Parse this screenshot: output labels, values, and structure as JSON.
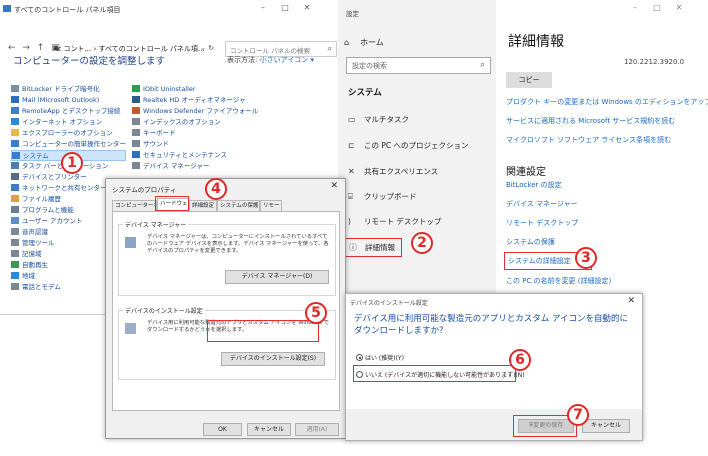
{
  "control_panel": {
    "title": "すべてのコントロール パネル項目",
    "path": "≪ コント... › すべてのコントロール パネル項...",
    "search_placeholder": "コントロール パネルの検索",
    "heading": "コンピューターの設定を調整します",
    "view_by_label": "表示方法:",
    "view_by_value": "小さいアイコン ▾",
    "col1": [
      {
        "label": "BitLocker ドライブ暗号化",
        "color": "#7a8fa8"
      },
      {
        "label": "Mail (Microsoft Outlook)",
        "color": "#2e6dbf"
      },
      {
        "label": "RemoteApp とデスクトップ接続",
        "color": "#3b7fc9"
      },
      {
        "label": "インターネット オプション",
        "color": "#2f88d6"
      },
      {
        "label": "エクスプローラーのオプション",
        "color": "#e5b94a"
      },
      {
        "label": "コンピューターの簡単操作センター",
        "color": "#3a7ed0"
      },
      {
        "label": "システム",
        "color": "#3a7ed0"
      },
      {
        "label": "タスク バーとナビゲーション",
        "color": "#4a7fb5"
      },
      {
        "label": "デバイスとプリンター",
        "color": "#5a6d80"
      },
      {
        "label": "ネットワークと共有センター",
        "color": "#3d7cc6"
      },
      {
        "label": "ファイル履歴",
        "color": "#e2a23a"
      },
      {
        "label": "プログラムと機能",
        "color": "#6b7f93"
      },
      {
        "label": "ユーザー アカウント",
        "color": "#5b8fc7"
      },
      {
        "label": "音声認識",
        "color": "#7a8a99"
      },
      {
        "label": "管理ツール",
        "color": "#7b8793"
      },
      {
        "label": "記憶域",
        "color": "#7b8793"
      },
      {
        "label": "自動再生",
        "color": "#3a9a55"
      },
      {
        "label": "地域",
        "color": "#2f88d6"
      },
      {
        "label": "電話とモデム",
        "color": "#7b8793"
      }
    ],
    "col2": [
      {
        "label": "IObit Uninstaller",
        "color": "#2aa04a"
      },
      {
        "label": "Realtek HD オーディオマネージャ",
        "color": "#2c5a8a"
      },
      {
        "label": "Windows Defender ファイアウォール",
        "color": "#c55a2a"
      },
      {
        "label": "インデックスのオプション",
        "color": "#7b8793"
      },
      {
        "label": "キーボード",
        "color": "#7b8793"
      },
      {
        "label": "サウンド",
        "color": "#7b8793"
      },
      {
        "label": "セキュリティとメンテナンス",
        "color": "#2e6dbf"
      },
      {
        "label": "デバイス マネージャー",
        "color": "#7b8793"
      }
    ]
  },
  "settings": {
    "title": "設定",
    "home": "ホーム",
    "search_placeholder": "設定の検索",
    "section": "システム",
    "nav": [
      {
        "icon": "▭",
        "label": "マルチタスク"
      },
      {
        "icon": "⊏",
        "label": "この PC へのプロジェクション"
      },
      {
        "icon": "✕",
        "label": "共有エクスペリエンス"
      },
      {
        "icon": "⌸",
        "label": "クリップボード"
      },
      {
        "icon": "⟩",
        "label": "リモート デスクトップ"
      },
      {
        "icon": "ⓘ",
        "label": "詳細情報"
      }
    ],
    "heading": "詳細情報",
    "version": "120.2212.3920.0",
    "copy_button": "コピー",
    "links": [
      "プロダクト キーの変更または Windows のエディションをアップグレード",
      "サービスに適用される Microsoft サービス規約を読む",
      "マイクロソフト ソフトウェア ライセンス条項を読む"
    ],
    "related_heading": "関連設定",
    "related_links": [
      "BitLocker の設定",
      "デバイス マネージャー",
      "リモート デスクトップ",
      "システムの保護",
      "システムの詳細設定",
      "この PC の名前を変更 (詳細設定)"
    ]
  },
  "system_properties": {
    "title": "システムのプロパティ",
    "tabs": [
      "コンピューター名",
      "ハードウェア",
      "詳細設定",
      "システムの保護",
      "リモート"
    ],
    "device_manager_group": "デバイス マネージャー",
    "device_manager_text": "デバイス マネージャーは、コンピューターにインストールされているすべてのハードウェア デバイスを表示します。デバイス マネージャーを使って、各デバイスのプロパティを変更できます。",
    "device_manager_button": "デバイス マネージャー(D)",
    "install_group": "デバイスのインストール設定",
    "install_text": "デバイス用に利用可能な製造元のアプリとカスタム アイコンを Windows でダウンロードするかどうかを選択します。",
    "install_button": "デバイスのインストール設定(S)",
    "ok": "OK",
    "cancel": "キャンセル",
    "apply": "適用(A)"
  },
  "device_install": {
    "title": "デバイスのインストール設定",
    "question": "デバイス用に利用可能な製造元のアプリとカスタム アイコンを自動的にダウンロードしますか?",
    "option_yes": "はい (推奨)(Y)",
    "option_no": "いいえ (デバイスが適切に機能しない可能性があります)(N)",
    "save": "変更の保存",
    "cancel": "キャンセル"
  },
  "markers": [
    "1",
    "2",
    "3",
    "4",
    "5",
    "6",
    "7"
  ],
  "colors": {
    "accent_link": "#1769c4",
    "highlight_red": "#e32626",
    "cp_heading": "#1e3f8a"
  }
}
